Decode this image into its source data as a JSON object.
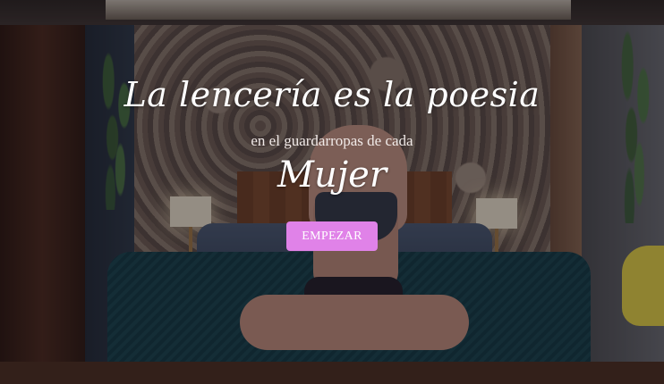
{
  "hero": {
    "headline": "La lencería es la poesia",
    "subline": "en el guardarropas de cada",
    "big_word": "Mujer",
    "cta_label": "EMPEZAR"
  },
  "colors": {
    "cta_background": "#e082e8",
    "text": "#ffffff",
    "overlay": "rgba(20,12,14,0.42)"
  }
}
